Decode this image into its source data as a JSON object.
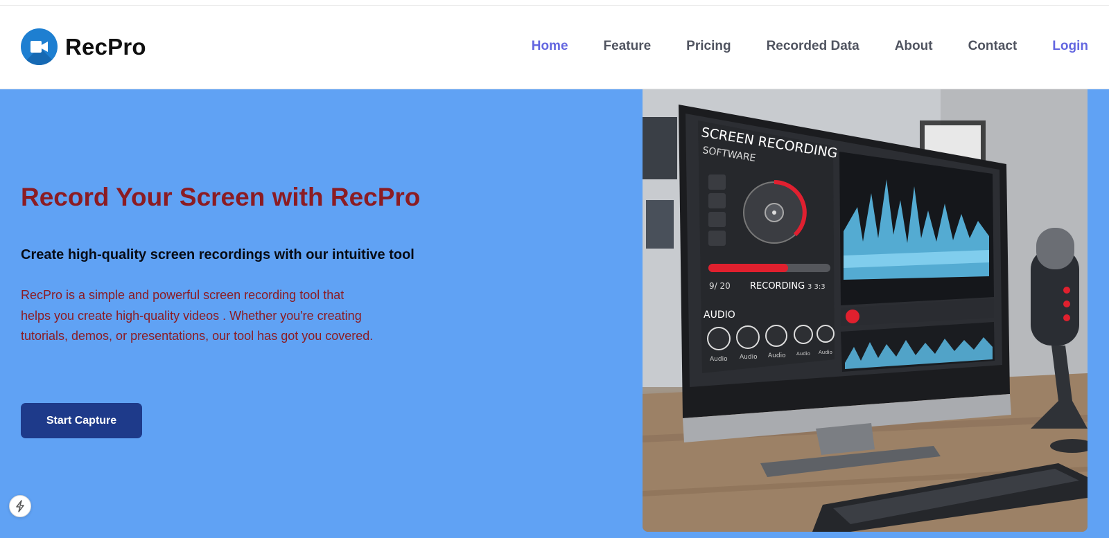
{
  "brand": {
    "name": "RecPro",
    "logo_icon": "video-camera-icon",
    "logo_color": "#1e7fd1"
  },
  "nav": {
    "items": [
      {
        "label": "Home",
        "active": true
      },
      {
        "label": "Feature",
        "active": false
      },
      {
        "label": "Pricing",
        "active": false
      },
      {
        "label": "Recorded Data",
        "active": false
      },
      {
        "label": "About",
        "active": false
      },
      {
        "label": "Contact",
        "active": false
      }
    ],
    "login_label": "Login",
    "active_color": "#6366e0"
  },
  "hero": {
    "title": "Record Your Screen with RecPro",
    "subtitle": "Create high-quality screen recordings with our intuitive tool",
    "description": "RecPro is a simple and powerful screen recording tool that helps you create high-quality videos . Whether you're creating tutorials, demos, or presentations, our tool has got you covered.",
    "cta_label": "Start Capture",
    "background_color": "#60a2f4",
    "title_color": "#8b1c23",
    "cta_color": "#1e3a8a"
  },
  "hero_image": {
    "screen_title_line1": "SCREEN RECORDING",
    "screen_title_line2": "SOFTWARE",
    "time_left": "9/ 20",
    "recording_label": "RECORDING",
    "time_right": "3 3:3",
    "audio_label": "AUDIO",
    "audio_buttons": [
      "Audio",
      "Audio",
      "Audio",
      "Audio",
      "Audio"
    ]
  },
  "floating_badge": {
    "icon": "lightning-bolt-icon"
  }
}
